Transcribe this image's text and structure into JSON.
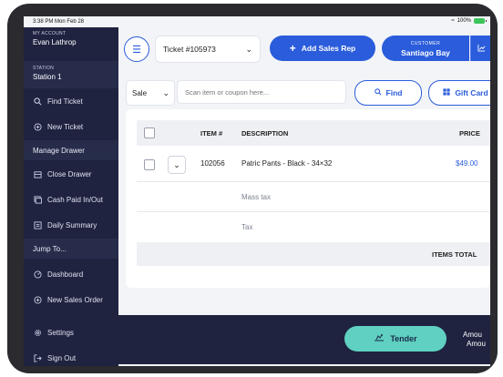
{
  "statusbar": {
    "time": "3:38 PM",
    "date": "Mon Feb 28",
    "battery": "100%"
  },
  "sidebar": {
    "account_label": "MY ACCOUNT",
    "account_name": "Evan Lathrop",
    "station_label": "STATION",
    "station_name": "Station 1",
    "items": [
      {
        "label": "Find Ticket",
        "icon": "search-icon"
      },
      {
        "label": "New Ticket",
        "icon": "plus-circle-icon"
      }
    ],
    "section_drawer": "Manage Drawer",
    "drawer_items": [
      {
        "label": "Close Drawer",
        "icon": "register-icon"
      },
      {
        "label": "Cash Paid In/Out",
        "icon": "cash-icon"
      },
      {
        "label": "Daily Summary",
        "icon": "summary-icon"
      }
    ],
    "section_jump": "Jump To...",
    "jump_items": [
      {
        "label": "Dashboard",
        "icon": "dashboard-icon"
      },
      {
        "label": "New Sales Order",
        "icon": "plus-circle-icon"
      }
    ],
    "settings": "Settings",
    "signout": "Sign Out"
  },
  "header": {
    "ticket": "Ticket #105973",
    "add_sales_rep": "Add Sales Rep",
    "customer_label": "CUSTOMER",
    "customer_name": "Santiago Bay"
  },
  "search": {
    "mode": "Sale",
    "placeholder": "Scan item or coupon here...",
    "find": "Find",
    "gift_card": "Gift Card"
  },
  "table": {
    "columns": {
      "item": "ITEM #",
      "description": "DESCRIPTION",
      "price": "PRICE"
    },
    "rows": [
      {
        "item": "102056",
        "description": "Patric Pants - Black - 34×32",
        "price": "$49.00"
      }
    ],
    "mass_tax": "Mass tax",
    "tax": "Tax",
    "items_total": "ITEMS TOTAL"
  },
  "footer": {
    "tender": "Tender",
    "amount_1": "Amou",
    "amount_2": "Amou"
  },
  "colors": {
    "accent": "#2a5cdb",
    "sidebar": "#1f2340",
    "tender": "#5fd0c1"
  }
}
